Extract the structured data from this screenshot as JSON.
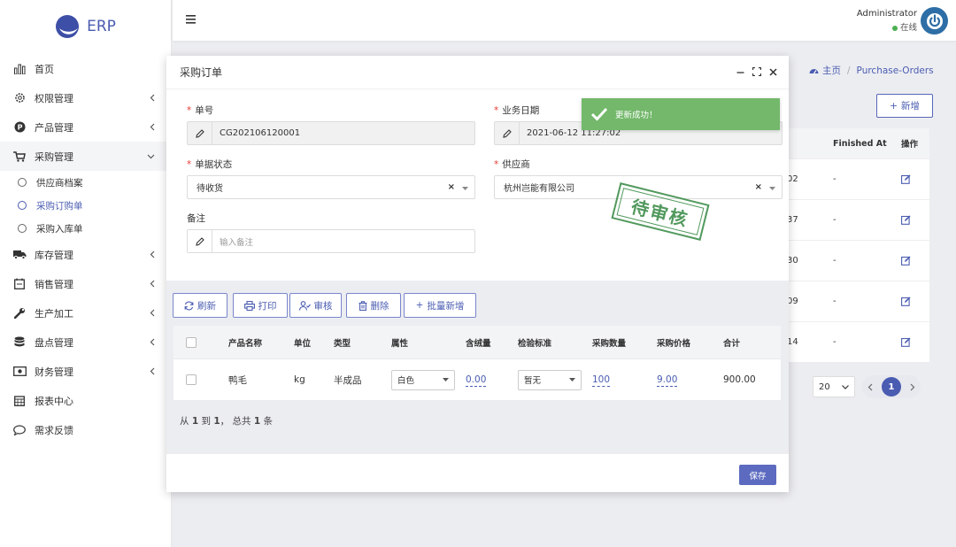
{
  "app": {
    "name": "ERP"
  },
  "sidebar": {
    "items": [
      {
        "label": "首页",
        "icon": "bar-chart-icon"
      },
      {
        "label": "权限管理",
        "icon": "gear-icon"
      },
      {
        "label": "产品管理",
        "icon": "p-circle-icon"
      },
      {
        "label": "采购管理",
        "icon": "cart-icon"
      },
      {
        "label": "库存管理",
        "icon": "truck-icon"
      },
      {
        "label": "销售管理",
        "icon": "calendar-list-icon"
      },
      {
        "label": "生产加工",
        "icon": "wrench-icon"
      },
      {
        "label": "盘点管理",
        "icon": "database-icon"
      },
      {
        "label": "财务管理",
        "icon": "money-icon"
      },
      {
        "label": "报表中心",
        "icon": "calendar-icon"
      },
      {
        "label": "需求反馈",
        "icon": "chat-icon"
      }
    ],
    "purchase_sub": [
      "供应商档案",
      "采购订购单",
      "采购入库单"
    ]
  },
  "header": {
    "user": "Administrator",
    "status": "在线"
  },
  "breadcrumb": {
    "home": "主页",
    "current": "Purchase-Orders"
  },
  "page": {
    "add_label": "新增"
  },
  "bg_table": {
    "headers": [
      "Finished At",
      "操作"
    ],
    "rows": [
      {
        "tail": "02",
        "finished": "-"
      },
      {
        "tail": "37",
        "finished": "-"
      },
      {
        "tail": "30",
        "finished": "-"
      },
      {
        "tail": "09",
        "finished": "-"
      },
      {
        "tail": "14",
        "finished": "-"
      }
    ]
  },
  "pagination": {
    "page_size": "20",
    "current": "1"
  },
  "modal": {
    "title": "采购订单",
    "fields": {
      "order_no": {
        "label": "单号",
        "value": "CG202106120001"
      },
      "biz_date": {
        "label": "业务日期",
        "value": "2021-06-12 11:27:02"
      },
      "status": {
        "label": "单据状态",
        "value": "待收货"
      },
      "supplier": {
        "label": "供应商",
        "value": "杭州岂能有限公司"
      },
      "remark": {
        "label": "备注",
        "placeholder": "输入备注"
      }
    },
    "toolbar": {
      "refresh": "刷新",
      "print": "打印",
      "audit": "审核",
      "delete": "删除",
      "batch_add": "批量新增"
    },
    "items_table": {
      "headers": [
        "产品名称",
        "单位",
        "类型",
        "属性",
        "含绒量",
        "检验标准",
        "采购数量",
        "采购价格",
        "合计"
      ],
      "rows": [
        {
          "name": "鸭毛",
          "unit": "kg",
          "type": "半成品",
          "attr": "白色",
          "down": "0.00",
          "standard": "暂无",
          "qty": "100",
          "price": "9.00",
          "total": "900.00"
        }
      ]
    },
    "summary": {
      "p1": "从 ",
      "from": "1",
      "p2": " 到 ",
      "to": "1",
      "p3": "， 总共 ",
      "total": "1",
      "p4": " 条"
    },
    "save_label": "保存"
  },
  "toast": {
    "message": "更新成功！"
  },
  "stamp": {
    "text": "待审核"
  },
  "colors": {
    "primary": "#4a5cb1",
    "success": "#73b86b",
    "stamp": "#3f8f4c"
  }
}
